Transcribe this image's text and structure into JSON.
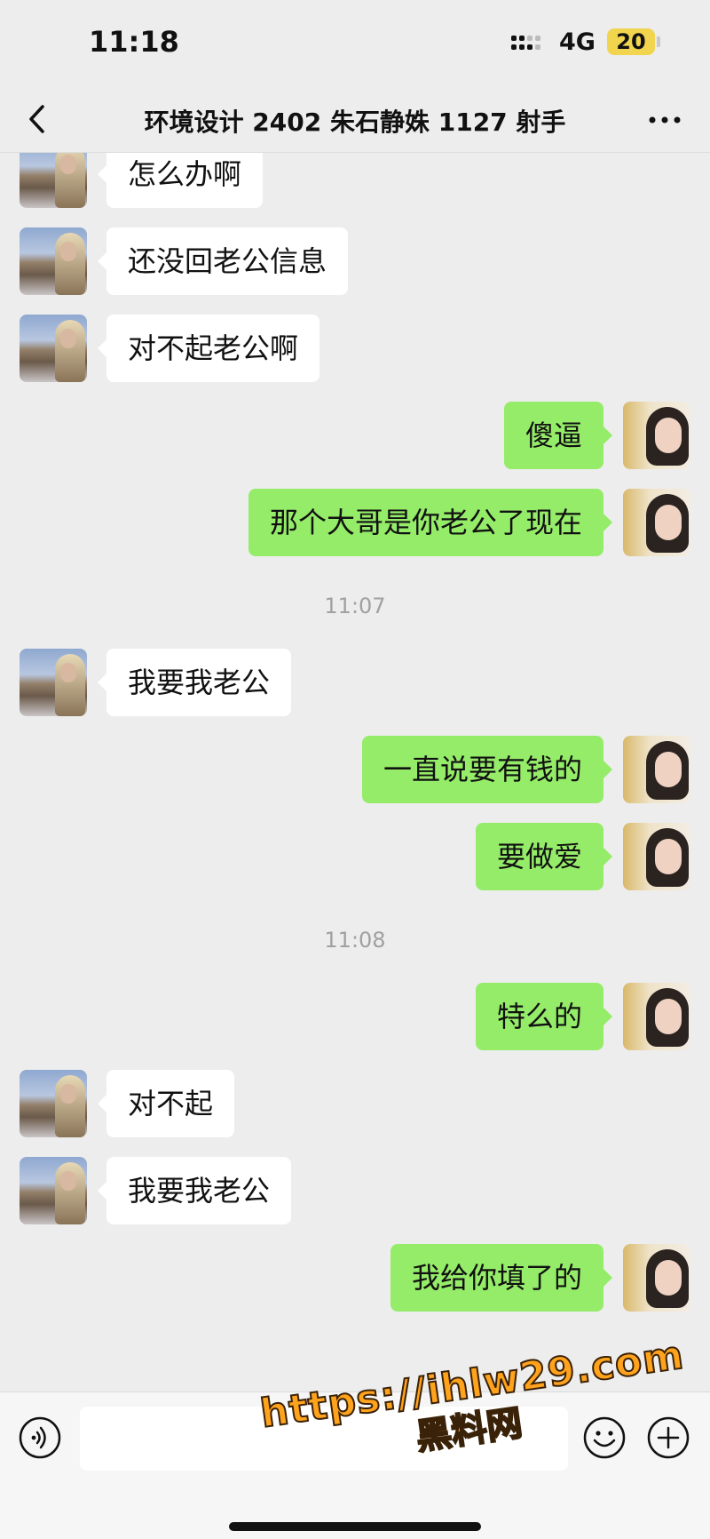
{
  "status_bar": {
    "time": "11:18",
    "network": "4G",
    "battery": "20"
  },
  "nav": {
    "title": "环境设计 2402 朱石静姝 1127 射手",
    "back_icon": "chevron-left-icon",
    "more_icon": "more-horizontal-icon"
  },
  "messages": [
    {
      "side": "in",
      "text": "怎么办啊"
    },
    {
      "side": "in",
      "text": "还没回老公信息"
    },
    {
      "side": "in",
      "text": "对不起老公啊"
    },
    {
      "side": "out",
      "text": "傻逼"
    },
    {
      "side": "out",
      "text": "那个大哥是你老公了现在"
    },
    {
      "side": "time",
      "text": "11:07"
    },
    {
      "side": "in",
      "text": "我要我老公"
    },
    {
      "side": "out",
      "text": "一直说要有钱的"
    },
    {
      "side": "out",
      "text": "要做爱"
    },
    {
      "side": "time",
      "text": "11:08"
    },
    {
      "side": "out",
      "text": "特么的"
    },
    {
      "side": "in",
      "text": "对不起"
    },
    {
      "side": "in",
      "text": "我要我老公"
    },
    {
      "side": "out",
      "text": "我给你填了的"
    }
  ],
  "input_bar": {
    "placeholder": "",
    "voice_icon": "voice-icon",
    "emoji_icon": "emoji-icon",
    "plus_icon": "plus-icon"
  },
  "watermark": {
    "url": "https://ihlw29.com",
    "label": "黑料网"
  },
  "colors": {
    "background": "#ededed",
    "outgoing_bubble": "#95ec69",
    "incoming_bubble": "#ffffff",
    "timestamp": "#a0a0a0",
    "battery": "#f1d54e",
    "watermark": "#ffa21c"
  }
}
